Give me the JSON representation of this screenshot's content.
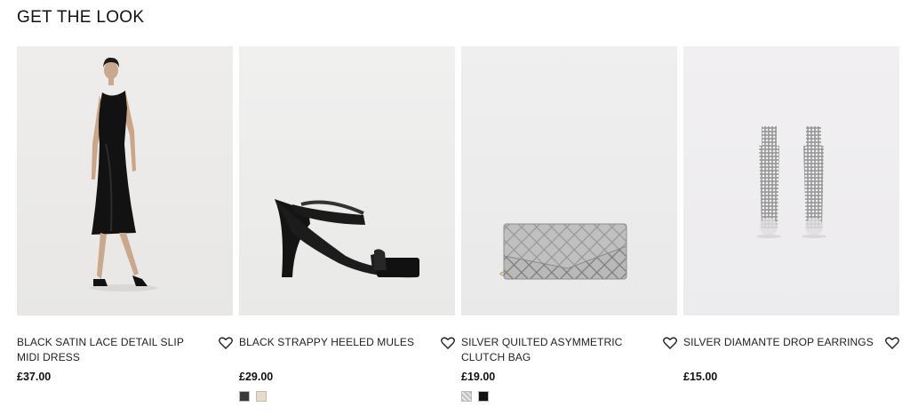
{
  "section": {
    "title": "GET THE LOOK"
  },
  "products": [
    {
      "name": "BLACK SATIN LACE DETAIL SLIP MIDI DRESS",
      "price": "£37.00",
      "image": "black-slip-dress-model",
      "swatches": []
    },
    {
      "name": "BLACK STRAPPY HEELED MULES",
      "price": "£29.00",
      "image": "black-heeled-mule",
      "swatches": [
        {
          "color": "#3a3a3a"
        },
        {
          "color": "#e9dcc6"
        }
      ]
    },
    {
      "name": "SILVER QUILTED ASYMMETRIC CLUTCH BAG",
      "price": "£19.00",
      "image": "silver-quilted-clutch",
      "swatches": [
        {
          "color": "#c8c8c8"
        },
        {
          "color": "#111111"
        }
      ]
    },
    {
      "name": "SILVER DIAMANTE DROP EARRINGS",
      "price": "£15.00",
      "image": "silver-drop-earrings",
      "swatches": []
    }
  ],
  "icons": {
    "wishlist": "heart-outline-icon"
  }
}
